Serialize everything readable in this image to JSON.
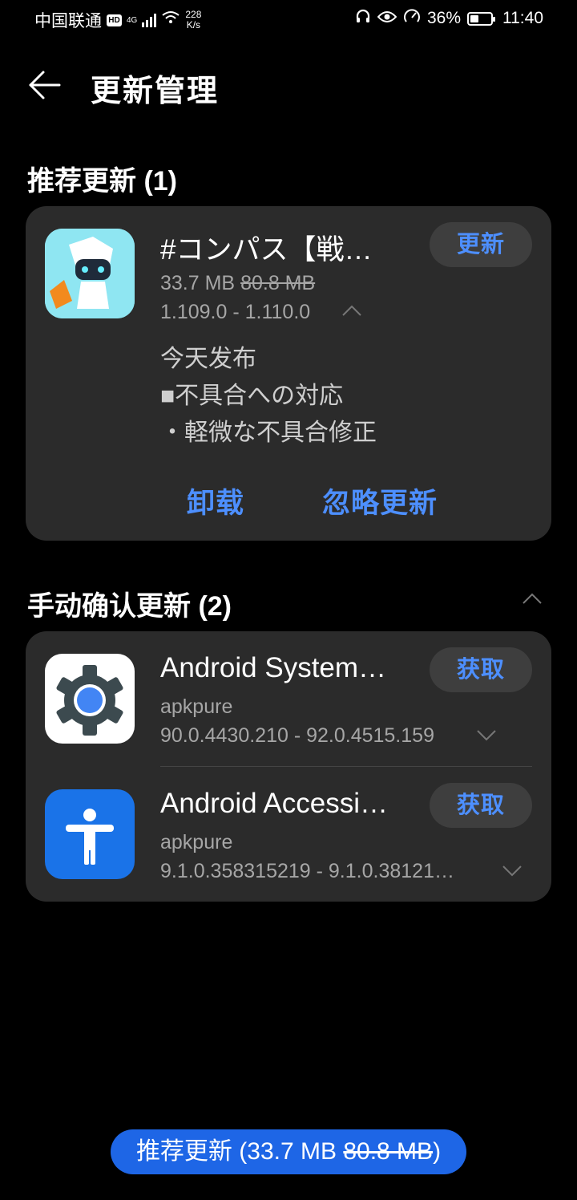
{
  "status_bar": {
    "carrier": "中国联通",
    "hd": "HD",
    "net_type": "4G",
    "speed_value": "228",
    "speed_unit": "K/s",
    "battery": "36%",
    "time": "11:40"
  },
  "header": {
    "title": "更新管理"
  },
  "recommended": {
    "title": "推荐更新 (1)",
    "app": {
      "name": "#コンパス【戦…",
      "size": "33.7 MB",
      "old_size": "80.8 MB",
      "versions": "1.109.0 - 1.110.0",
      "button": "更新",
      "notes": [
        "今天发布",
        "■不具合への対応",
        "・軽微な不具合修正"
      ],
      "uninstall": "卸载",
      "ignore": "忽略更新"
    }
  },
  "manual": {
    "title": "手动确认更新 (2)",
    "apps": [
      {
        "name": "Android System…",
        "source": "apkpure",
        "versions": "90.0.4430.210 - 92.0.4515.159",
        "button": "获取"
      },
      {
        "name": "Android Accessi…",
        "source": "apkpure",
        "versions": "9.1.0.358315219 - 9.1.0.38121…",
        "button": "获取"
      }
    ]
  },
  "bottom": {
    "label_prefix": "推荐更新 (33.7 MB ",
    "label_old": "80.8 MB",
    "label_suffix": ")"
  },
  "colors": {
    "accent": "#4d8fff",
    "card": "#2b2b2b",
    "primary_button": "#1e66e6"
  }
}
